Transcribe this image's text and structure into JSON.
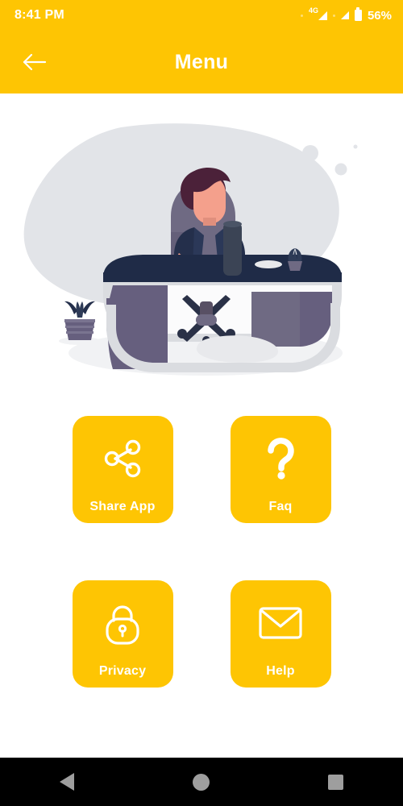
{
  "statusbar": {
    "time": "8:41 PM",
    "network_type": "4G",
    "battery_percent": "56%",
    "icons": [
      "signal-4g-icon",
      "signal-bars-icon",
      "battery-icon"
    ]
  },
  "appbar": {
    "title": "Menu",
    "back_icon": "arrow-left-icon",
    "background_color": "#FEC503",
    "text_color": "#FFFFFF"
  },
  "illustration": {
    "name": "person-at-desk-illustration",
    "description": "Flat illustration of a person working at a curved pill-shaped desk",
    "colors": {
      "blob": "#E2E4E8",
      "desk_top": "#1F2B47",
      "desk_edge": "#DADCE0",
      "desk_panel": "#665F7E",
      "hair": "#4B2139",
      "skin": "#F4A08C",
      "jacket": "#242F4B",
      "shirt": "#6F6A83",
      "floor_shadow": "#EFF0F2"
    }
  },
  "menu": {
    "tiles": [
      {
        "label": "Share App",
        "icon": "share-icon"
      },
      {
        "label": "Faq",
        "icon": "question-mark-icon"
      },
      {
        "label": "Privacy",
        "icon": "lock-icon"
      },
      {
        "label": "Help",
        "icon": "envelope-icon"
      }
    ],
    "tile_color": "#FEC503",
    "tile_text_color": "#FFFFFF"
  },
  "navbar": {
    "buttons": [
      {
        "name": "back",
        "icon": "triangle-left-icon"
      },
      {
        "name": "home",
        "icon": "circle-icon"
      },
      {
        "name": "recents",
        "icon": "square-icon"
      }
    ],
    "background_color": "#000000",
    "icon_color": "#9E9E9E"
  }
}
